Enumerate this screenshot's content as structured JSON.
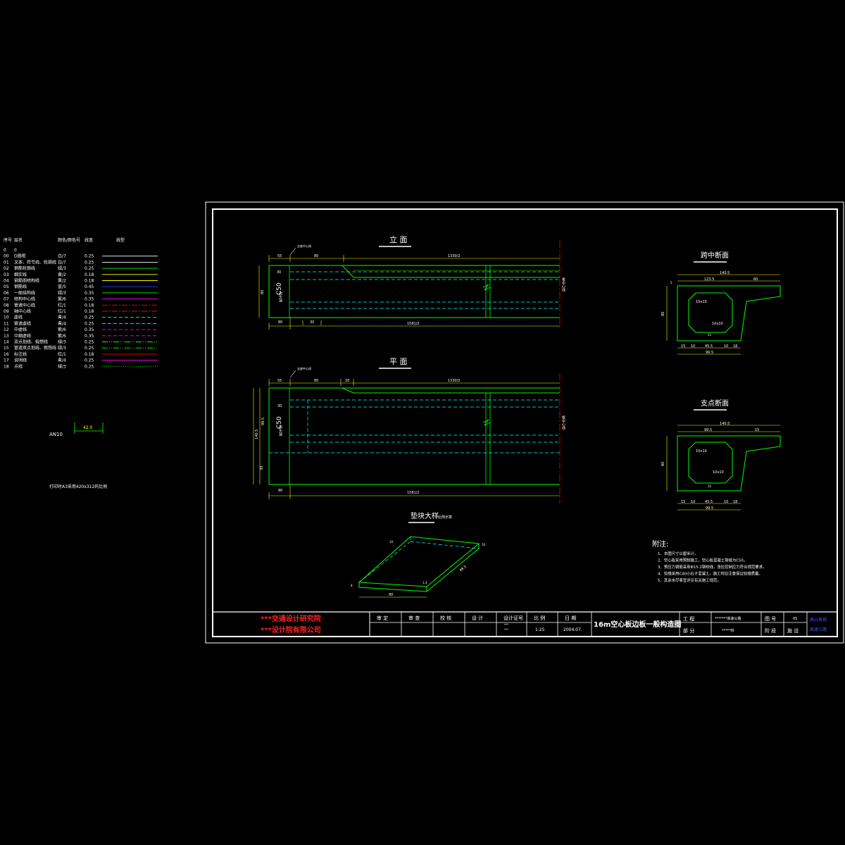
{
  "layers": {
    "headers": {
      "seq": "序号",
      "name": "层名",
      "color": "颜色/颜色号",
      "lineweight": "线宽",
      "linetype": "线型"
    },
    "rows": [
      {
        "seq": "0",
        "name": "0",
        "color": "",
        "lw": "",
        "hex": "#ffffff",
        "dash": ""
      },
      {
        "seq": "00",
        "name": "D图框",
        "color": "白/7",
        "lw": "0.25",
        "hex": "#ffffff",
        "dash": ""
      },
      {
        "seq": "01",
        "name": "文本、符号线、轮廓线",
        "color": "白/7",
        "lw": "0.25",
        "hex": "#ffffff",
        "dash": ""
      },
      {
        "seq": "02",
        "name": "钢筋轮廓线",
        "color": "绿/3",
        "lw": "0.25",
        "hex": "#00ff00",
        "dash": ""
      },
      {
        "seq": "03",
        "name": "细实线",
        "color": "黄/2",
        "lw": "0.18",
        "hex": "#ffff00",
        "dash": ""
      },
      {
        "seq": "04",
        "name": "钢筋图结构线",
        "color": "黄/2",
        "lw": "0.18",
        "hex": "#ffff00",
        "dash": ""
      },
      {
        "seq": "05",
        "name": "钢筋线",
        "color": "蓝/5",
        "lw": "0.45",
        "hex": "#3333ff",
        "dash": ""
      },
      {
        "seq": "06",
        "name": "一般结构线",
        "color": "绿/3",
        "lw": "0.35",
        "hex": "#00ff00",
        "dash": ""
      },
      {
        "seq": "07",
        "name": "结构中心线",
        "color": "紫/6",
        "lw": "0.35",
        "hex": "#ff00ff",
        "dash": ""
      },
      {
        "seq": "08",
        "name": "管道中心线",
        "color": "红/1",
        "lw": "0.18",
        "hex": "#ff0000",
        "dash": "8 2 2 2"
      },
      {
        "seq": "09",
        "name": "轴中心线",
        "color": "红/1",
        "lw": "0.18",
        "hex": "#ff0000",
        "dash": "8 2 2 2"
      },
      {
        "seq": "10",
        "name": "虚线",
        "color": "青/4",
        "lw": "0.25",
        "hex": "#00ffff",
        "dash": "5 3"
      },
      {
        "seq": "11",
        "name": "管道虚线",
        "color": "青/4",
        "lw": "0.25",
        "hex": "#00ffff",
        "dash": "5 3"
      },
      {
        "seq": "12",
        "name": "中虚线",
        "color": "紫/6",
        "lw": "0.35",
        "hex": "#ff00ff",
        "dash": "5 3"
      },
      {
        "seq": "13",
        "name": "中细虚线",
        "color": "紫/6",
        "lw": "0.35",
        "hex": "#ff00ff",
        "dash": "5 3"
      },
      {
        "seq": "14",
        "name": "双点划线、假想线",
        "color": "绿/3",
        "lw": "0.25",
        "hex": "#00ff00",
        "dash": "8 2 1 2 1 2"
      },
      {
        "seq": "15",
        "name": "管道双点划线、假想线",
        "color": "绿/3",
        "lw": "0.25",
        "hex": "#00ff00",
        "dash": "8 2 1 2 1 2"
      },
      {
        "seq": "16",
        "name": "标注线",
        "color": "红/1",
        "lw": "0.18",
        "hex": "#ff0000",
        "dash": ""
      },
      {
        "seq": "17",
        "name": "说明线",
        "color": "青/4",
        "lw": "0.25",
        "hex": "#ff00ff",
        "dash": ""
      },
      {
        "seq": "18",
        "name": "点线",
        "color": "绿/3",
        "lw": "0.25",
        "hex": "#00ff00",
        "dash": "1 2"
      }
    ],
    "an_label": "AN10",
    "an_value": "42.0",
    "print_note": "打印时A3采用420x312的比例"
  },
  "drawing": {
    "elevation": {
      "title": "立  面",
      "support_label": "支座中心线",
      "dims_top": [
        "55",
        "80",
        "1330/2"
      ],
      "dim_left": "80",
      "dim_left_small": "30",
      "dim_bottom": [
        "80",
        "30",
        "1581/2"
      ],
      "concrete": "C50",
      "anchor_text": "封头混",
      "center_text": "板中心线"
    },
    "plan": {
      "title": "平  面",
      "support_label": "支座中心线",
      "dims_top": [
        "55",
        "80",
        "20",
        "1330/2"
      ],
      "dims_left": [
        "30",
        "99.5",
        "140.5",
        "30"
      ],
      "dim_bottom": [
        "80",
        "1581/2"
      ],
      "concrete": "C50",
      "anchor_text": "封头混",
      "center_text": "板中心线"
    },
    "mid_section": {
      "title": "跨中断面",
      "dims_top": [
        "140.5",
        "123.5",
        "60"
      ],
      "dims_bottom": [
        "15",
        "10",
        "45.5",
        "10",
        "18"
      ],
      "dim_total": "99.5",
      "chamfer_labels": [
        "10x10",
        "10x10"
      ],
      "left_dims": [
        "5",
        "80"
      ],
      "inner": "22"
    },
    "support_section": {
      "title": "支点断面",
      "dims_top": [
        "140.5",
        "99.5",
        "15"
      ],
      "dims_bottom": [
        "15",
        "10",
        "45.5",
        "10",
        "18"
      ],
      "dim_total": "99.5",
      "chamfer_labels": [
        "10x10",
        "10x10"
      ],
      "left_dims": [
        "80"
      ],
      "inner": "22"
    },
    "pad_detail": {
      "title": "垫块大样",
      "scale": "比例示意",
      "dims": [
        "80",
        "8",
        "1.4",
        "48.5",
        "10",
        "10"
      ]
    },
    "notes": {
      "title": "附注:",
      "items": [
        "1、本图尺寸以厘米计。",
        "2、空心板采用预制施工，空心板混凝土等级为C50。",
        "3、预应力钢筋采用Φ15.2钢绞线，张拉控制应力符合规范要求。",
        "4、铰缝采用C40小石子混凝土，施工时应注意保证铰缝质量。",
        "5、其余未尽事宜详见有关施工规范。"
      ]
    }
  },
  "title_block": {
    "org_line1": "***交通设计研究院",
    "org_line2": "***设计院有限公司",
    "headers": [
      "审 定",
      "审 查",
      "校 核",
      "设 计",
      "设计证号",
      "比 例",
      "日 期"
    ],
    "cert_values": [
      "***",
      "***"
    ],
    "scale": "1:25",
    "date": "2004.07.",
    "drawing_title": "16m空心板边板一般构造图",
    "project_label": "工 程",
    "project_value": "*******高速公路",
    "part_label": "部 分",
    "part_value": "*****桥",
    "sheet_no_label": "图 号",
    "sheet_no_value": "05",
    "stage_label": "阶 段",
    "stage_value": "施 设",
    "stamp_line1": "高山景观",
    "stamp_line2": "高速公路"
  },
  "colors": {
    "background": "#000000",
    "frame": "#ffffff",
    "structure": "#00ff00",
    "hidden": "#00ffff",
    "dimension": "#ffff00",
    "centerline": "#ff0000",
    "text": "#ffffff",
    "org_text": "#ff2222",
    "stamp": "#3355ff"
  }
}
